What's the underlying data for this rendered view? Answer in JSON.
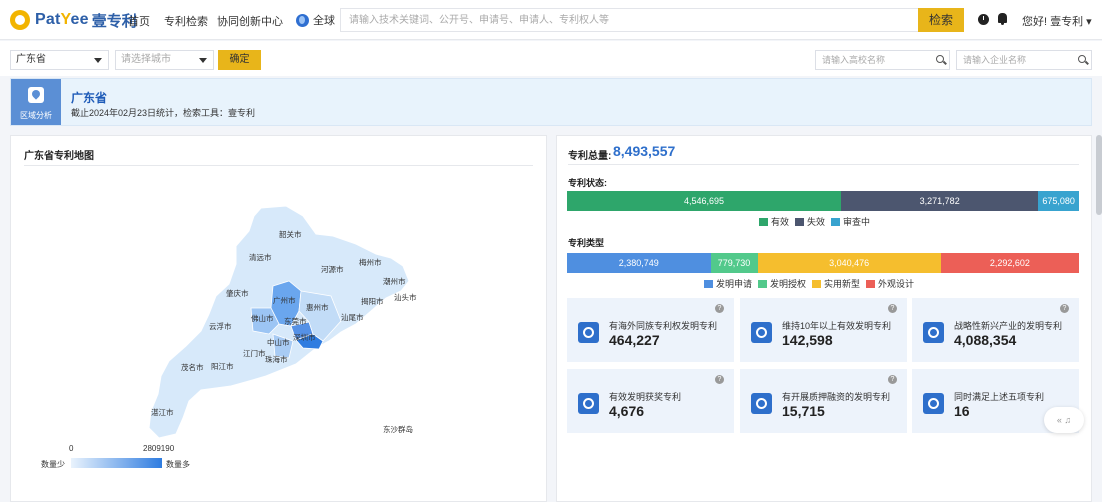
{
  "brand": {
    "name_pre": "Pat",
    "name_em": "Y",
    "name_post": "ee",
    "name_cn": "壹专利"
  },
  "nav": [
    {
      "label": "首页"
    },
    {
      "label": "专利检索"
    },
    {
      "label": "协同创新中心"
    }
  ],
  "search": {
    "scope": "全球",
    "placeholder": "请输入技术关键词、公开号、申请号、申请人、专利权人等",
    "button": "检索"
  },
  "user": {
    "greeting": "您好! 壹专利 ▾"
  },
  "filter": {
    "province": "广东省",
    "city_placeholder": "请选择城市",
    "confirm": "确定",
    "university_placeholder": "请输入高校名称",
    "company_placeholder": "请输入企业名称"
  },
  "banner": {
    "tag": "区域分析",
    "title": "广东省",
    "subtitle": "截止2024年02月23日统计，检索工具：壹专利"
  },
  "map": {
    "title": "广东省专利地图",
    "cities": [
      "韶关市",
      "清远市",
      "河源市",
      "梅州市",
      "潮州市",
      "肇庆市",
      "广州市",
      "惠州市",
      "揭阳市",
      "云浮市",
      "佛山市",
      "东莞市",
      "汕尾市",
      "汕头市",
      "深圳市",
      "中山市",
      "江门市",
      "茂名市",
      "阳江市",
      "珠海市",
      "湛江市",
      "东沙群岛"
    ],
    "legend": {
      "min": "0",
      "max": "2809190",
      "low_label": "数量少",
      "high_label": "数量多"
    }
  },
  "summary": {
    "total_label": "专利总量:",
    "total_value": "8,493,557",
    "status_label": "专利状态:",
    "type_label": "专利类型"
  },
  "chart_data": [
    {
      "type": "bar",
      "title": "专利状态",
      "orientation": "horizontal-stacked",
      "series": [
        {
          "name": "有效",
          "value": 4546695,
          "display": "4,546,695",
          "color": "#2ea66b"
        },
        {
          "name": "失效",
          "value": 3271782,
          "display": "3,271,782",
          "color": "#4c566f"
        },
        {
          "name": "审查中",
          "value": 675080,
          "display": "675,080",
          "color": "#38a3cf"
        }
      ]
    },
    {
      "type": "bar",
      "title": "专利类型",
      "orientation": "horizontal-stacked",
      "series": [
        {
          "name": "发明申请",
          "value": 2380749,
          "display": "2,380,749",
          "color": "#4f8fe0"
        },
        {
          "name": "发明授权",
          "value": 779730,
          "display": "779,730",
          "color": "#52c98b"
        },
        {
          "name": "实用新型",
          "value": 3040476,
          "display": "3,040,476",
          "color": "#f5be2e"
        },
        {
          "name": "外观设计",
          "value": 2292602,
          "display": "2,292,602",
          "color": "#ec5f57"
        }
      ]
    }
  ],
  "stats": [
    {
      "label": "有海外同族专利权发明专利",
      "value": "464,227",
      "icon": "globe-icon"
    },
    {
      "label": "维持10年以上有效发明专利",
      "value": "142,598",
      "icon": "target-icon"
    },
    {
      "label": "战略性新兴产业的发明专利",
      "value": "4,088,354",
      "icon": "map-icon"
    },
    {
      "label": "有效发明获奖专利",
      "value": "4,676",
      "icon": "medal-icon"
    },
    {
      "label": "有开展质押融资的发明专利",
      "value": "15,715",
      "icon": "hand-coin-icon"
    },
    {
      "label": "同时满足上述五项专利",
      "value": "16",
      "icon": "check-circle-icon"
    }
  ],
  "float": {
    "label": "« ♫"
  }
}
